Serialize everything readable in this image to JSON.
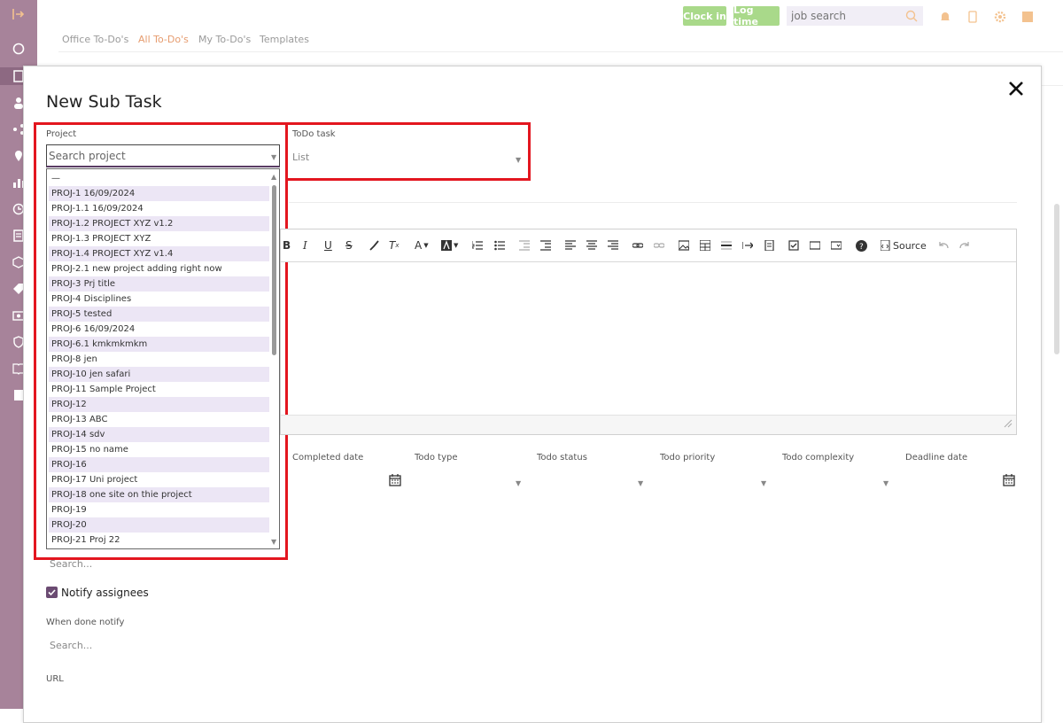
{
  "topbar": {
    "clock_in": "Clock in",
    "log_time": "Log time",
    "search_placeholder": "job search"
  },
  "tabs": [
    "Office To-Do's",
    "All To-Do's",
    "My To-Do's",
    "Templates"
  ],
  "modal": {
    "title": "New Sub Task",
    "project_label": "Project",
    "project_placeholder": "Search project",
    "todo_task_label": "ToDo task",
    "todo_task_value": "List",
    "project_options": [
      "—",
      "PROJ-1 16/09/2024",
      "PROJ-1.1 16/09/2024",
      "PROJ-1.2 PROJECT XYZ v1.2",
      "PROJ-1.3 PROJECT XYZ",
      "PROJ-1.4 PROJECT XYZ v1.4",
      "PROJ-2.1 new project adding right now",
      "PROJ-3 Prj title",
      "PROJ-4 Disciplines",
      "PROJ-5 tested",
      "PROJ-6 16/09/2024",
      "PROJ-6.1 kmkmkmkm",
      "PROJ-8 jen",
      "PROJ-10 jen safari",
      "PROJ-11 Sample Project",
      "PROJ-12",
      "PROJ-13 ABC",
      "PROJ-14 sdv",
      "PROJ-15 no name",
      "PROJ-16",
      "PROJ-17 Uni project",
      "PROJ-18 one site on thie project",
      "PROJ-19",
      "PROJ-20",
      "PROJ-21 Proj 22"
    ],
    "editor": {
      "source_label": "Source"
    },
    "fields": {
      "completed_date": "Completed date",
      "todo_type": "Todo type",
      "todo_status": "Todo status",
      "todo_priority": "Todo priority",
      "todo_complexity": "Todo complexity",
      "deadline_date": "Deadline date"
    },
    "assignees_search_placeholder": "Search...",
    "notify_assignees": "Notify assignees",
    "when_done_notify_label": "When done notify",
    "when_done_search_placeholder": "Search...",
    "url_label": "URL"
  },
  "colors": {
    "sidebar": "#a7839a",
    "green_button": "#a9d98a",
    "active_tab": "#e69c6f",
    "highlight_red": "#e3161f",
    "option_alt_bg": "#ece6f5",
    "checkbox": "#6b4b72"
  }
}
